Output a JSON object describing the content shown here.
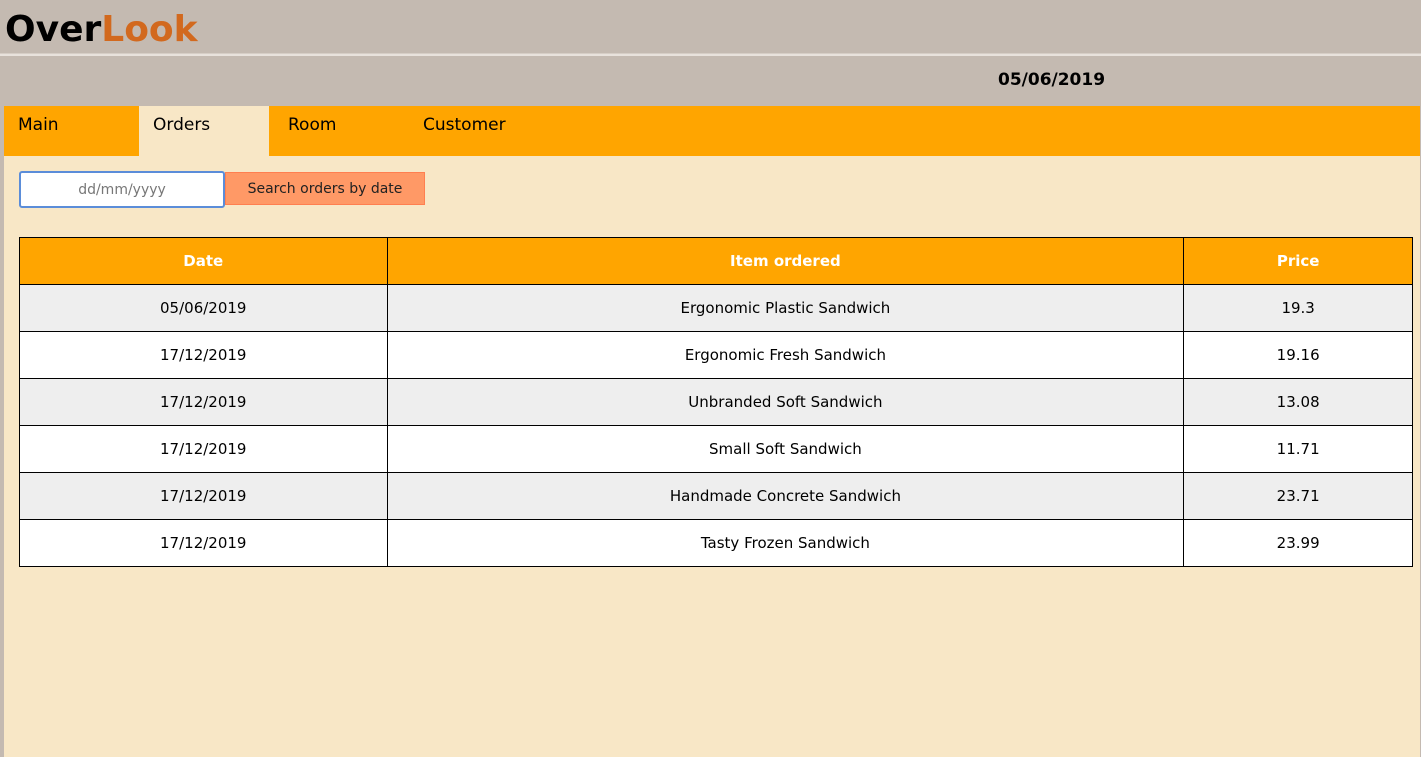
{
  "app": {
    "logo_part1": "Over",
    "logo_part2": "Look",
    "current_date": "05/06/2019"
  },
  "tabs": [
    {
      "label": "Main",
      "active": false
    },
    {
      "label": "Orders",
      "active": true
    },
    {
      "label": "Room",
      "active": false
    },
    {
      "label": "Customer",
      "active": false
    }
  ],
  "search": {
    "placeholder": "dd/mm/yyyy",
    "value": "",
    "button_label": "Search orders by date"
  },
  "orders_table": {
    "headers": [
      "Date",
      "Item ordered",
      "Price"
    ],
    "rows": [
      {
        "date": "05/06/2019",
        "item": "Ergonomic Plastic Sandwich",
        "price": "19.3"
      },
      {
        "date": "17/12/2019",
        "item": "Ergonomic Fresh Sandwich",
        "price": "19.16"
      },
      {
        "date": "17/12/2019",
        "item": "Unbranded Soft Sandwich",
        "price": "13.08"
      },
      {
        "date": "17/12/2019",
        "item": "Small Soft Sandwich",
        "price": "11.71"
      },
      {
        "date": "17/12/2019",
        "item": "Handmade Concrete Sandwich",
        "price": "23.71"
      },
      {
        "date": "17/12/2019",
        "item": "Tasty Frozen Sandwich",
        "price": "23.99"
      }
    ]
  },
  "colors": {
    "header_bg": "#c4bab1",
    "logo_accent": "#d2691e",
    "tab_bar": "#ffa500",
    "active_tab": "#f8e7c6",
    "content_bg": "#f8e7c6",
    "button_bg": "#ff9966",
    "row_alt": "#eeeeee"
  }
}
